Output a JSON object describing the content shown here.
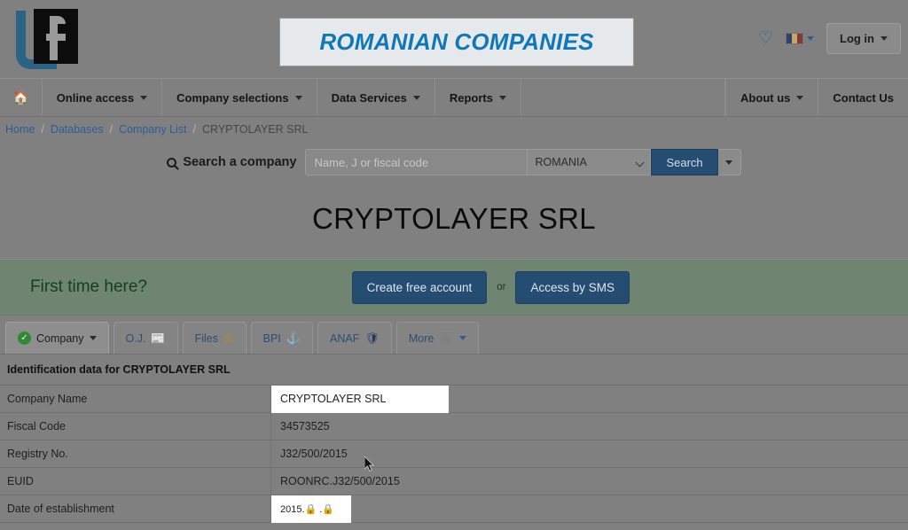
{
  "header": {
    "logo_alt": "Lf logo",
    "banner_text": "ROMANIAN COMPANIES",
    "favorites_icon": "heart-icon",
    "flag_label": "RO",
    "login_label": "Log in"
  },
  "nav": {
    "home_icon": "home-icon",
    "items": [
      {
        "label": "Online access",
        "caret": true
      },
      {
        "label": "Company selections",
        "caret": true
      },
      {
        "label": "Data Services",
        "caret": true
      },
      {
        "label": "Reports",
        "caret": true
      }
    ],
    "right_items": [
      {
        "label": "About us",
        "caret": true
      },
      {
        "label": "Contact Us",
        "caret": false
      }
    ]
  },
  "breadcrumb": {
    "items": [
      "Home",
      "Databases",
      "Company List"
    ],
    "current": "CRYPTOLAYER SRL",
    "separator": "/"
  },
  "search": {
    "label": "Search a company",
    "placeholder": "Name, J or fiscal code",
    "value": "",
    "country_selected": "ROMANIA",
    "country_options": [
      "ROMANIA"
    ],
    "button_label": "Search"
  },
  "company": {
    "title": "CRYPTOLAYER SRL"
  },
  "promo": {
    "text": "First time here?",
    "primary_button": "Create free account",
    "or_text": "or",
    "secondary_button": "Access by SMS"
  },
  "tabs": [
    {
      "label": "Company",
      "icon": "check-circle-icon",
      "caret": true,
      "active": true
    },
    {
      "label": "O.J.",
      "icon": "newspaper-icon",
      "caret": false,
      "active": false
    },
    {
      "label": "Files",
      "icon": "scales-icon",
      "caret": false,
      "active": false
    },
    {
      "label": "BPI",
      "icon": "anchor-icon",
      "caret": false,
      "active": false
    },
    {
      "label": "ANAF",
      "icon": "shield-icon",
      "caret": false,
      "active": false
    },
    {
      "label": "More",
      "icon": "image-icon",
      "caret": true,
      "active": false
    }
  ],
  "identification": {
    "section_title": "Identification data for CRYPTOLAYER SRL",
    "rows": [
      {
        "label": "Company Name",
        "value": "CRYPTOLAYER SRL",
        "highlight": true,
        "narrow": false
      },
      {
        "label": "Fiscal Code",
        "value": "34573525",
        "highlight": false,
        "narrow": false
      },
      {
        "label": "Registry No.",
        "value": "J32/500/2015",
        "highlight": false,
        "narrow": false
      },
      {
        "label": "EUID",
        "value": "ROONRC.J32/500/2015",
        "highlight": false,
        "narrow": false
      },
      {
        "label": "Date of establishment",
        "value": "2015.🔒 .🔒",
        "highlight": true,
        "narrow": true
      }
    ]
  },
  "colors": {
    "page_background": "#808080",
    "brand_blue": "#1178b8",
    "button_blue": "#254d72",
    "link_blue": "#2e5c9a",
    "promo_green": "#6f8471",
    "check_green": "#2e8b33",
    "highlight_white": "#ffffff"
  }
}
